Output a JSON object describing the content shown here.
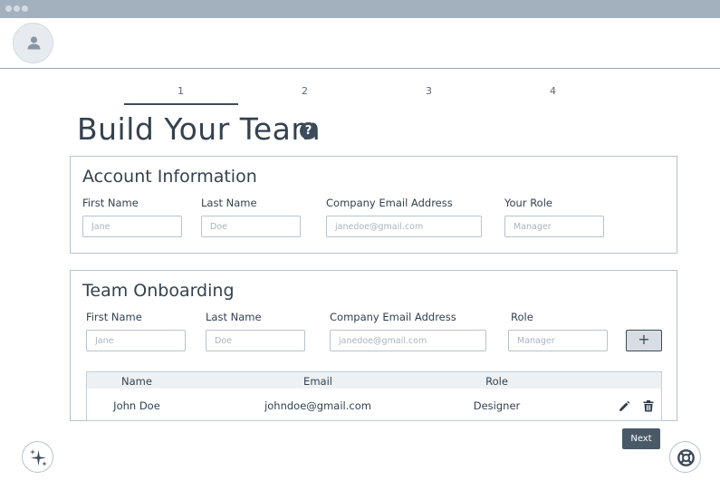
{
  "stepper": {
    "steps": [
      "1",
      "2",
      "3",
      "4"
    ],
    "active_step": "1"
  },
  "page": {
    "title": "Build Your Team",
    "help_icon": "?"
  },
  "account": {
    "title": "Account Information",
    "fields": [
      {
        "label": "First Name",
        "placeholder": "Jane"
      },
      {
        "label": "Last Name",
        "placeholder": "Doe"
      },
      {
        "label": "Company Email Address",
        "placeholder": "janedoe@gmail.com"
      },
      {
        "label": "Your Role",
        "placeholder": "Manager"
      }
    ]
  },
  "onboarding": {
    "title": "Team Onboarding",
    "fields": [
      {
        "label": "First Name",
        "placeholder": "Jane"
      },
      {
        "label": "Last Name",
        "placeholder": "Doe"
      },
      {
        "label": "Company Email Address",
        "placeholder": "janedoe@gmail.com"
      },
      {
        "label": "Role",
        "placeholder": "Manager"
      }
    ],
    "add_label": "+",
    "table": {
      "columns": [
        "Name",
        "Email",
        "Role"
      ],
      "rows": [
        {
          "name": "John Doe",
          "email": "johndoe@gmail.com",
          "role": "Designer"
        }
      ]
    }
  },
  "footer": {
    "next_label": "Next"
  },
  "icons": {
    "avatar": "user-icon",
    "help": "question-icon",
    "edit": "pencil-icon",
    "delete": "trash-icon",
    "ai": "sparkles-icon",
    "support": "lifebuoy-icon"
  },
  "colors": {
    "titlebar": "#a3b0bd",
    "primary": "#4a5968",
    "border": "#b8c2cc"
  }
}
